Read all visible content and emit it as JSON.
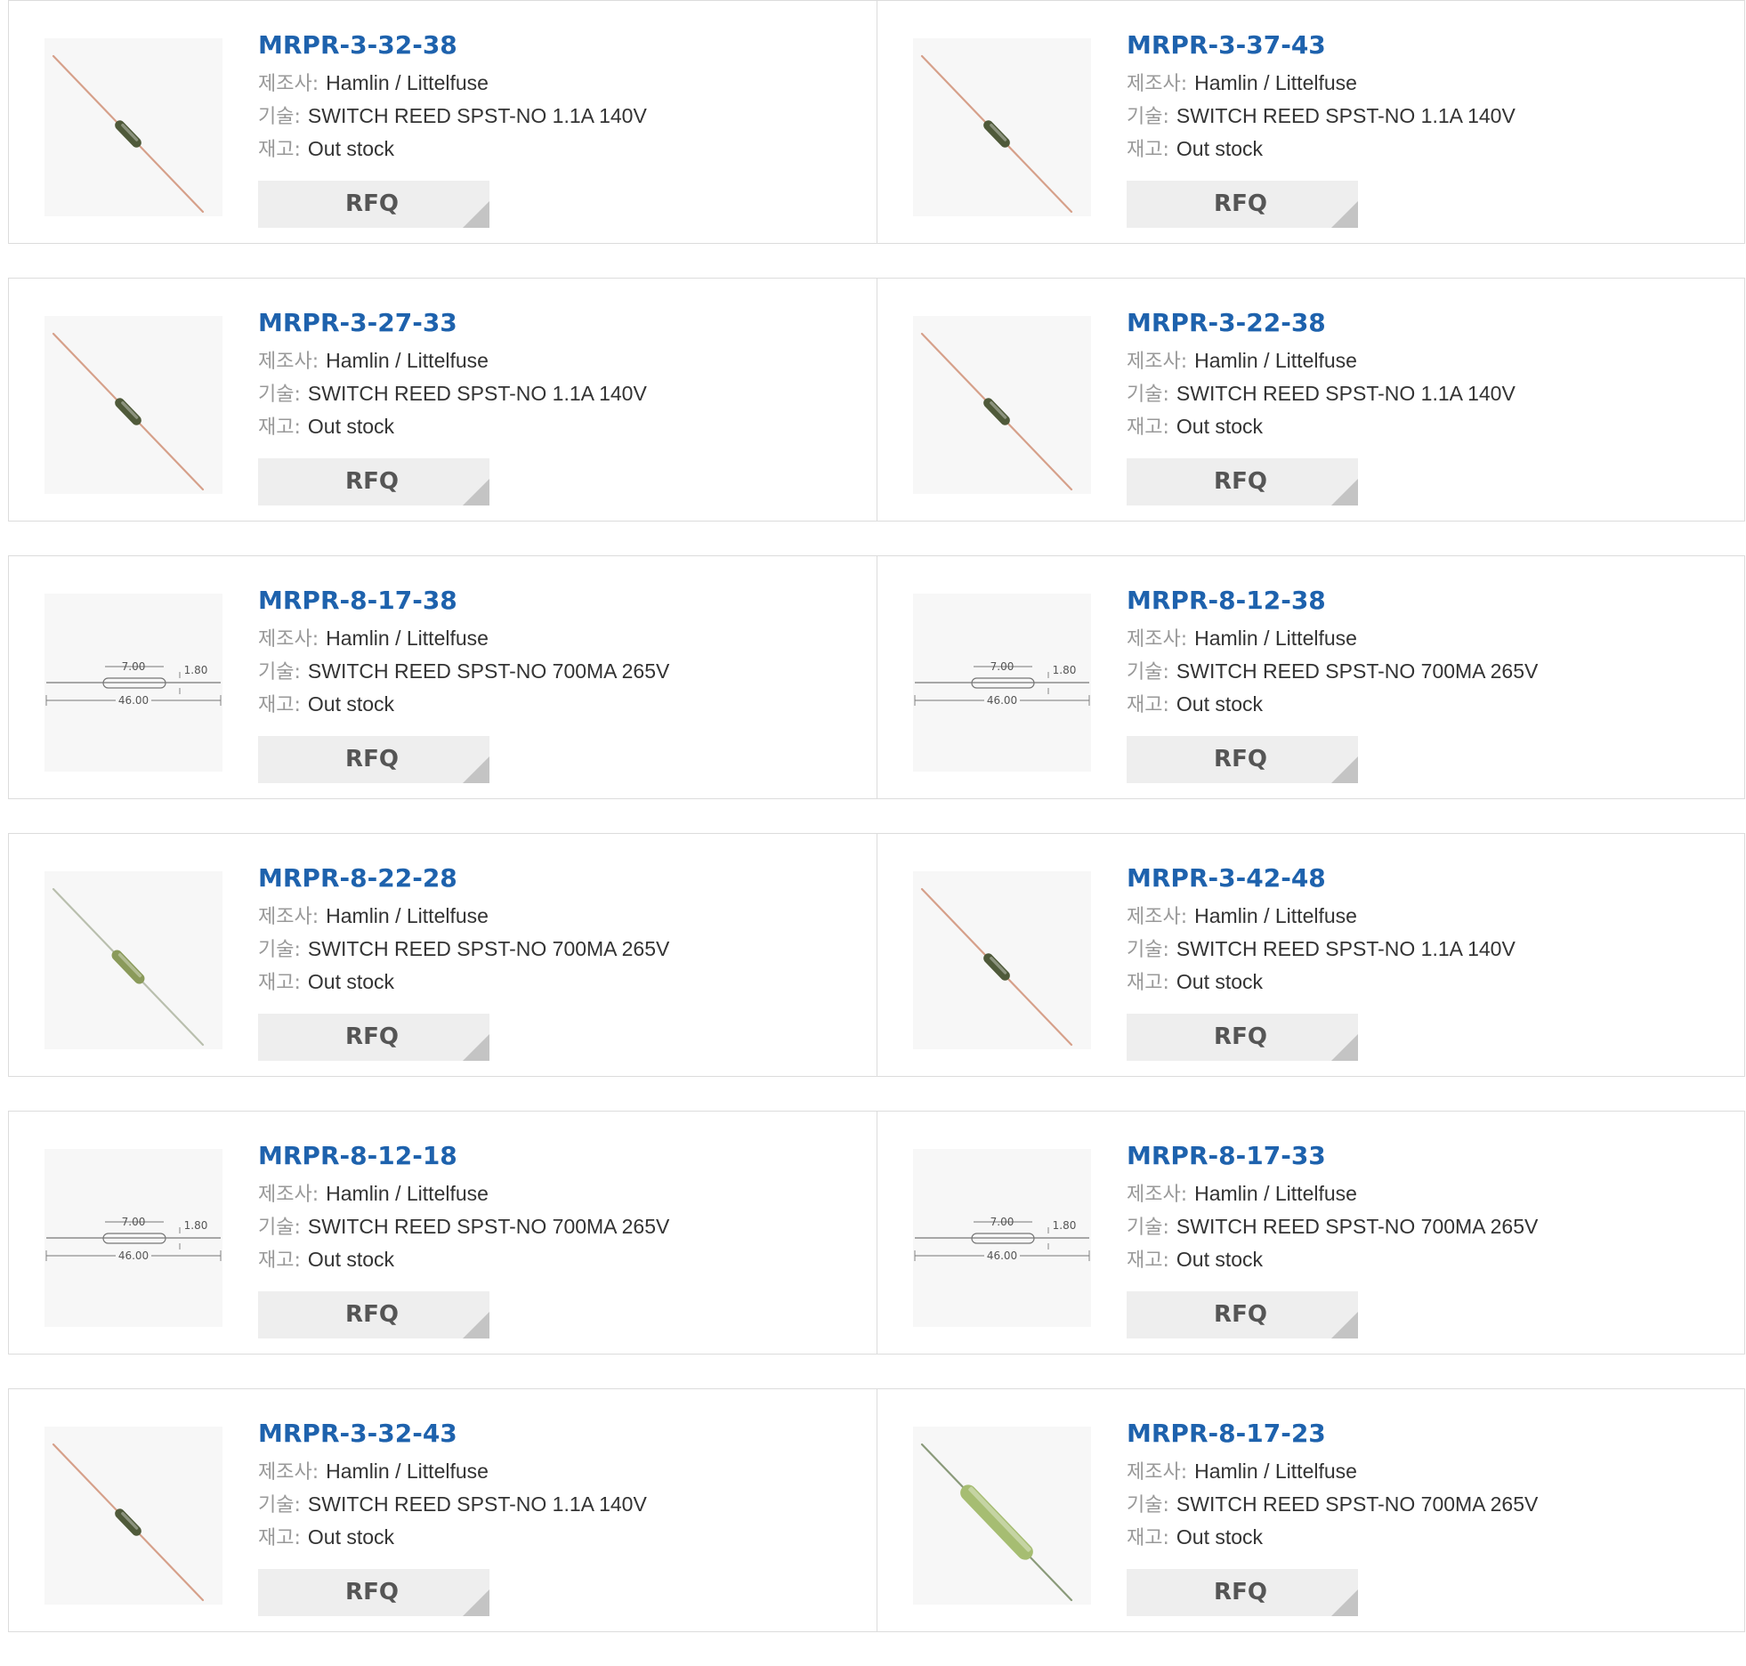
{
  "labels": {
    "manufacturer": "제조사:",
    "description": "기술:",
    "stock": "재고:"
  },
  "colors": {
    "part_number": "#1e62ad",
    "label": "#999999",
    "text": "#333333",
    "rfq_bg": "#eeeeee",
    "border": "#dcdcdc"
  },
  "products": [
    {
      "part": "MRPR-3-32-38",
      "manufacturer": "Hamlin / Littelfuse",
      "description": "SWITCH REED SPST-NO 1.1A 140V",
      "stock": "Out stock",
      "rfq": "RFQ",
      "image": "reed-switch-amber"
    },
    {
      "part": "MRPR-3-37-43",
      "manufacturer": "Hamlin / Littelfuse",
      "description": "SWITCH REED SPST-NO 1.1A 140V",
      "stock": "Out stock",
      "rfq": "RFQ",
      "image": "reed-switch-amber"
    },
    {
      "part": "MRPR-3-27-33",
      "manufacturer": "Hamlin / Littelfuse",
      "description": "SWITCH REED SPST-NO 1.1A 140V",
      "stock": "Out stock",
      "rfq": "RFQ",
      "image": "reed-switch-amber"
    },
    {
      "part": "MRPR-3-22-38",
      "manufacturer": "Hamlin / Littelfuse",
      "description": "SWITCH REED SPST-NO 1.1A 140V",
      "stock": "Out stock",
      "rfq": "RFQ",
      "image": "reed-switch-amber"
    },
    {
      "part": "MRPR-8-17-38",
      "manufacturer": "Hamlin / Littelfuse",
      "description": "SWITCH REED SPST-NO 700MA 265V",
      "stock": "Out stock",
      "rfq": "RFQ",
      "image": "reed-switch-drawing"
    },
    {
      "part": "MRPR-8-12-38",
      "manufacturer": "Hamlin / Littelfuse",
      "description": "SWITCH REED SPST-NO 700MA 265V",
      "stock": "Out stock",
      "rfq": "RFQ",
      "image": "reed-switch-drawing"
    },
    {
      "part": "MRPR-8-22-28",
      "manufacturer": "Hamlin / Littelfuse",
      "description": "SWITCH REED SPST-NO 700MA 265V",
      "stock": "Out stock",
      "rfq": "RFQ",
      "image": "reed-switch-clear"
    },
    {
      "part": "MRPR-3-42-48",
      "manufacturer": "Hamlin / Littelfuse",
      "description": "SWITCH REED SPST-NO 1.1A 140V",
      "stock": "Out stock",
      "rfq": "RFQ",
      "image": "reed-switch-amber"
    },
    {
      "part": "MRPR-8-12-18",
      "manufacturer": "Hamlin / Littelfuse",
      "description": "SWITCH REED SPST-NO 700MA 265V",
      "stock": "Out stock",
      "rfq": "RFQ",
      "image": "reed-switch-drawing"
    },
    {
      "part": "MRPR-8-17-33",
      "manufacturer": "Hamlin / Littelfuse",
      "description": "SWITCH REED SPST-NO 700MA 265V",
      "stock": "Out stock",
      "rfq": "RFQ",
      "image": "reed-switch-drawing"
    },
    {
      "part": "MRPR-3-32-43",
      "manufacturer": "Hamlin / Littelfuse",
      "description": "SWITCH REED SPST-NO 1.1A 140V",
      "stock": "Out stock",
      "rfq": "RFQ",
      "image": "reed-switch-amber"
    },
    {
      "part": "MRPR-8-17-23",
      "manufacturer": "Hamlin / Littelfuse",
      "description": "SWITCH REED SPST-NO 700MA 265V",
      "stock": "Out stock",
      "rfq": "RFQ",
      "image": "reed-switch-green"
    }
  ],
  "drawing": {
    "dim_length": "46.00",
    "dim_glass": "7.00",
    "dim_dia": "1.80"
  }
}
